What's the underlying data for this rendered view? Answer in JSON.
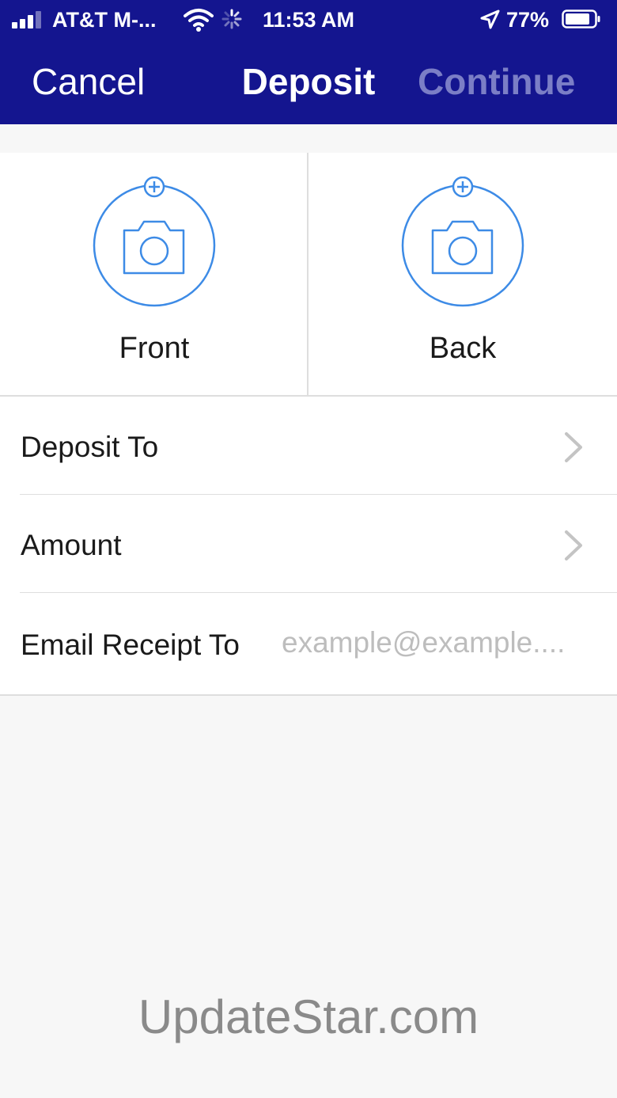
{
  "status_bar": {
    "carrier": "AT&T M-...",
    "time": "11:53 AM",
    "battery": "77%",
    "icons": [
      "signal-bars-icon",
      "wifi-icon",
      "activity-spinner-icon",
      "location-arrow-icon",
      "battery-icon"
    ]
  },
  "nav": {
    "cancel_label": "Cancel",
    "title": "Deposit",
    "continue_label": "Continue"
  },
  "capture": {
    "front_label": "Front",
    "back_label": "Back",
    "icon": "camera-add-icon"
  },
  "form": {
    "deposit_to_label": "Deposit To",
    "amount_label": "Amount",
    "email_label": "Email Receipt To",
    "email_value": "",
    "email_placeholder": "example@example...."
  },
  "watermark": "UpdateStar.com",
  "colors": {
    "header_bg": "#14158f",
    "accent_blue": "#3d8be6",
    "continue_disabled": "#7b7ec6"
  }
}
